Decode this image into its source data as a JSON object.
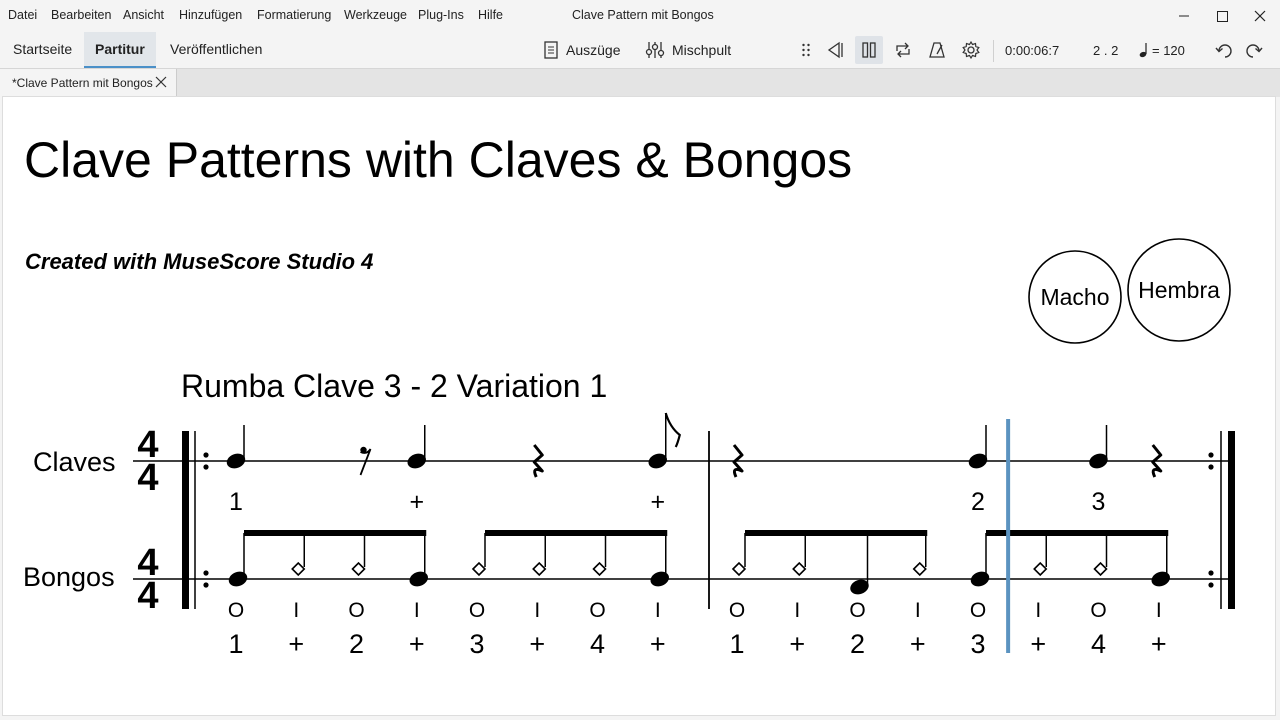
{
  "menu": {
    "items": [
      "Datei",
      "Bearbeiten",
      "Ansicht",
      "Hinzufügen",
      "Formatierung",
      "Werkzeuge",
      "Plug-Ins",
      "Hilfe"
    ],
    "window_title": "Clave Pattern mit Bongos"
  },
  "toolbar": {
    "tabs": [
      "Startseite",
      "Partitur",
      "Veröffentlichen"
    ],
    "active_tab": "Partitur",
    "parts_label": "Auszüge",
    "mixer_label": "Mischpult",
    "time": "0:00:06:7",
    "position": "2 . 2",
    "tempo_label": "= 120"
  },
  "document_tab": {
    "label": "*Clave Pattern mit Bongos"
  },
  "score": {
    "title": "Clave Patterns with Claves & Bongos",
    "subtitle": "Created with MuseScore Studio 4",
    "circle_left": "Macho",
    "circle_right": "Hembra",
    "section_title": "Rumba Clave 3 - 2 Variation 1",
    "instruments": [
      "Claves",
      "Bongos"
    ],
    "time_signature": {
      "numerator": "4",
      "denominator": "4"
    },
    "claves_counts": [
      {
        "beat": 0,
        "text": "1"
      },
      {
        "beat": 1.5,
        "text": "+"
      },
      {
        "beat": 3.5,
        "text": "+"
      },
      {
        "beat": 6,
        "text": "2"
      },
      {
        "beat": 7,
        "text": "3"
      }
    ],
    "bongo_strokes": [
      "O",
      "I",
      "O",
      "I",
      "O",
      "I",
      "O",
      "I",
      "O",
      "I",
      "O",
      "I",
      "O",
      "I",
      "O",
      "I"
    ],
    "bongo_counts": [
      "1",
      "+",
      "2",
      "+",
      "3",
      "+",
      "4",
      "+",
      "1",
      "+",
      "2",
      "+",
      "3",
      "+",
      "4",
      "+"
    ],
    "playback_beat": 6.25
  },
  "colors": {
    "accent": "#4a90c8",
    "playhead": "#5b93c0"
  }
}
